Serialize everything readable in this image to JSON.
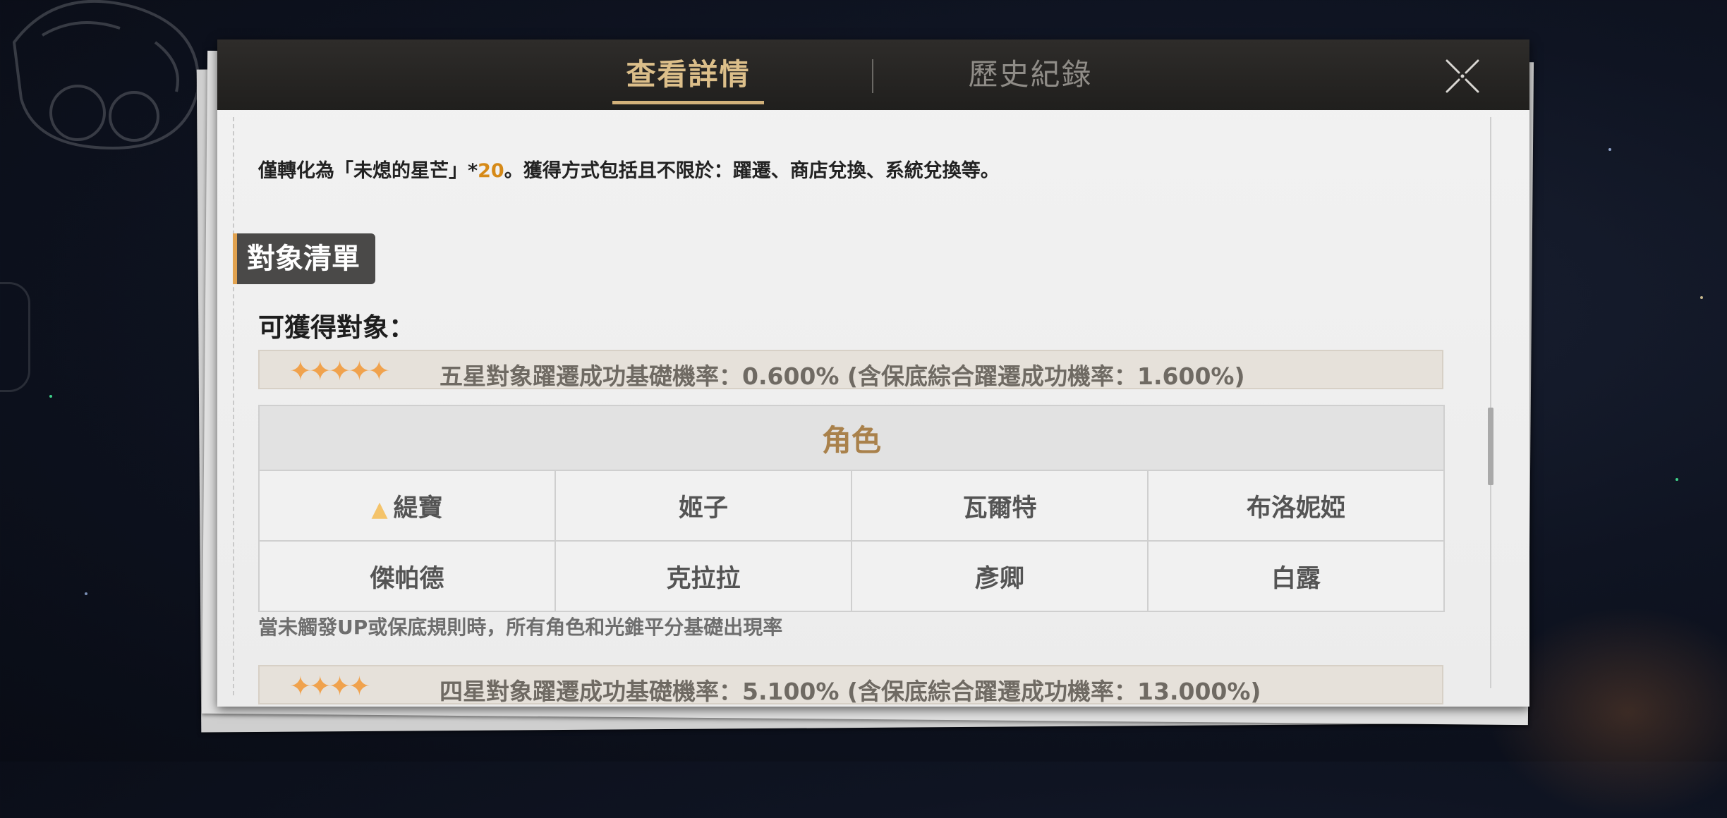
{
  "tabs": {
    "details": "查看詳情",
    "history": "歷史紀錄"
  },
  "intro": {
    "prefix": "僅轉化為「未熄的星芒」*",
    "count": "20",
    "suffix": "。獲得方式包括且不限於：躍遷、商店兌換、系統兌換等。"
  },
  "section_title": "對象清單",
  "obtainable_label": "可獲得對象：",
  "five_star": {
    "stars": "✦✦✦✦✦",
    "rate_text": "五星對象躍遷成功基礎機率：0.600% (含保底綜合躍遷成功機率：1.600%)"
  },
  "character_table": {
    "header": "角色",
    "rows": [
      [
        "緹寶",
        "姬子",
        "瓦爾特",
        "布洛妮婭"
      ],
      [
        "傑帕德",
        "克拉拉",
        "彥卿",
        "白露"
      ]
    ]
  },
  "note": "當未觸發UP或保底規則時，所有角色和光錐平分基礎出現率",
  "four_star": {
    "stars": "✦✦✦✦",
    "rate_text": "四星對象躍遷成功基礎機率：5.100% (含保底綜合躍遷成功機率：13.000%)"
  },
  "colors": {
    "accent_gold": "#dcbf8a",
    "star_orange": "#f0a24d",
    "highlight_number": "#d68a18"
  }
}
